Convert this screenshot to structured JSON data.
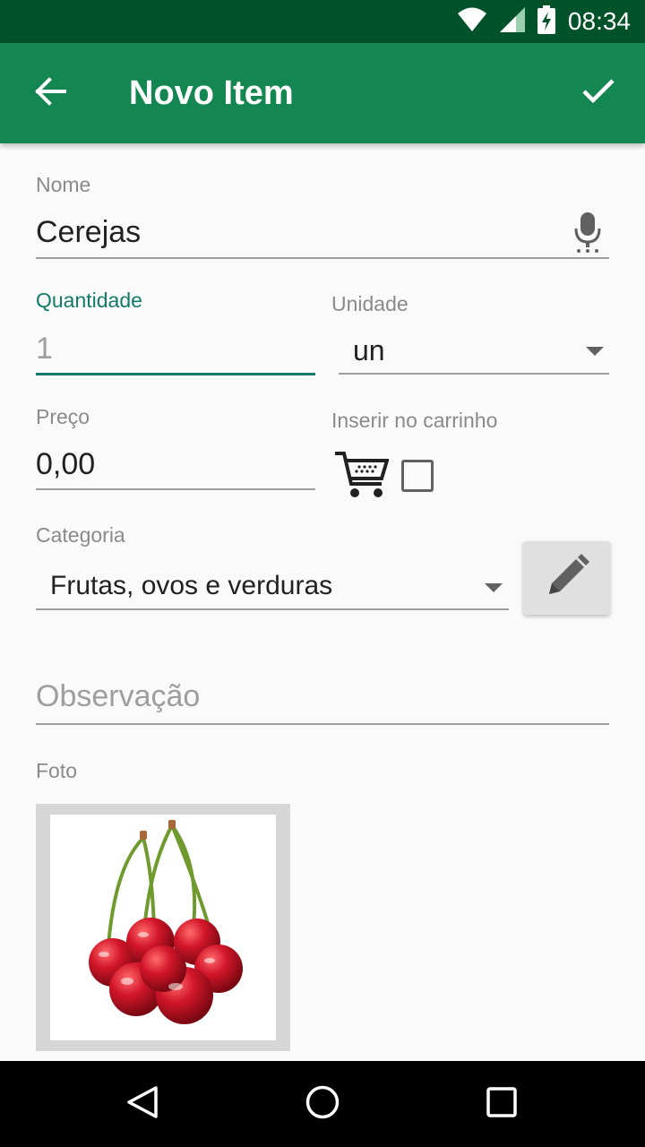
{
  "status_bar": {
    "time": "08:34",
    "icons": [
      "wifi-icon",
      "signal-icon",
      "battery-charging-icon"
    ]
  },
  "app_bar": {
    "title": "Novo Item",
    "back_icon": "arrow-left-icon",
    "confirm_icon": "check-icon"
  },
  "form": {
    "nome": {
      "label": "Nome",
      "value": "Cerejas",
      "icon": "microphone-icon"
    },
    "quantidade": {
      "label": "Quantidade",
      "placeholder": "1"
    },
    "unidade": {
      "label": "Unidade",
      "value": "un"
    },
    "preco": {
      "label": "Preço",
      "value": "0,00"
    },
    "carrinho": {
      "label": "Inserir no carrinho",
      "checked": false,
      "icon": "shopping-cart-icon"
    },
    "categoria": {
      "label": "Categoria",
      "value": "Frutas, ovos e verduras",
      "edit_icon": "pencil-icon"
    },
    "observacao": {
      "placeholder": "Observação"
    },
    "foto": {
      "label": "Foto",
      "image": "cherries-photo"
    }
  },
  "colors": {
    "status_bar": "#00522a",
    "app_bar": "#148652",
    "accent": "#117a68",
    "cherry_red": "#c8102e"
  },
  "nav_bar": {
    "icons": [
      "back-triangle-icon",
      "home-circle-icon",
      "recents-square-icon"
    ]
  }
}
